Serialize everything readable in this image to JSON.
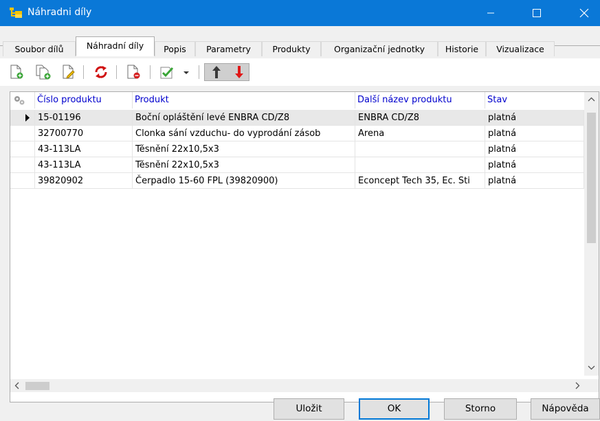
{
  "window": {
    "title": "Náhradni díly",
    "titlebar_color": "#0a78d7"
  },
  "tabs": [
    {
      "label": "Soubor dílů",
      "active": false
    },
    {
      "label": "Náhradní díly",
      "active": true
    },
    {
      "label": "Popis",
      "active": false
    },
    {
      "label": "Parametry",
      "active": false
    },
    {
      "label": "Produkty",
      "active": false
    },
    {
      "label": "Organizační jednotky",
      "active": false
    },
    {
      "label": "Historie",
      "active": false
    },
    {
      "label": "Vizualizace",
      "active": false
    }
  ],
  "toolbar": {
    "icons": [
      "new-record-icon",
      "copy-record-icon",
      "edit-record-icon",
      "refresh-icon",
      "delete-record-icon",
      "approve-icon",
      "dropdown-arrow-icon",
      "move-up-icon",
      "move-down-icon"
    ]
  },
  "grid": {
    "columns": [
      "Číslo produktu",
      "Produkt",
      "Další název produktu",
      "Stav"
    ],
    "header_color": "#0000cd",
    "rows": [
      {
        "cislo": "15-01196",
        "produkt": "Boční opláštění levé ENBRA CD/Z8",
        "dalsi": "ENBRA CD/Z8",
        "stav": "platná",
        "selected": true
      },
      {
        "cislo": "32700770",
        "produkt": "Clonka sání vzduchu- do vyprodání zásob",
        "dalsi": "Arena",
        "stav": "platná",
        "selected": false
      },
      {
        "cislo": "43-113LA",
        "produkt": "Těsnění 22x10,5x3",
        "dalsi": "",
        "stav": "platná",
        "selected": false
      },
      {
        "cislo": "43-113LA",
        "produkt": "Těsnění 22x10,5x3",
        "dalsi": "",
        "stav": "platná",
        "selected": false
      },
      {
        "cislo": "39820902",
        "produkt": "Čerpadlo 15-60 FPL (39820900)",
        "dalsi": "Econcept Tech 35, Ec. Sti",
        "stav": "platná",
        "selected": false
      }
    ]
  },
  "buttons": {
    "save": "Uložit",
    "ok": "OK",
    "cancel": "Storno",
    "help": "Nápověda"
  }
}
